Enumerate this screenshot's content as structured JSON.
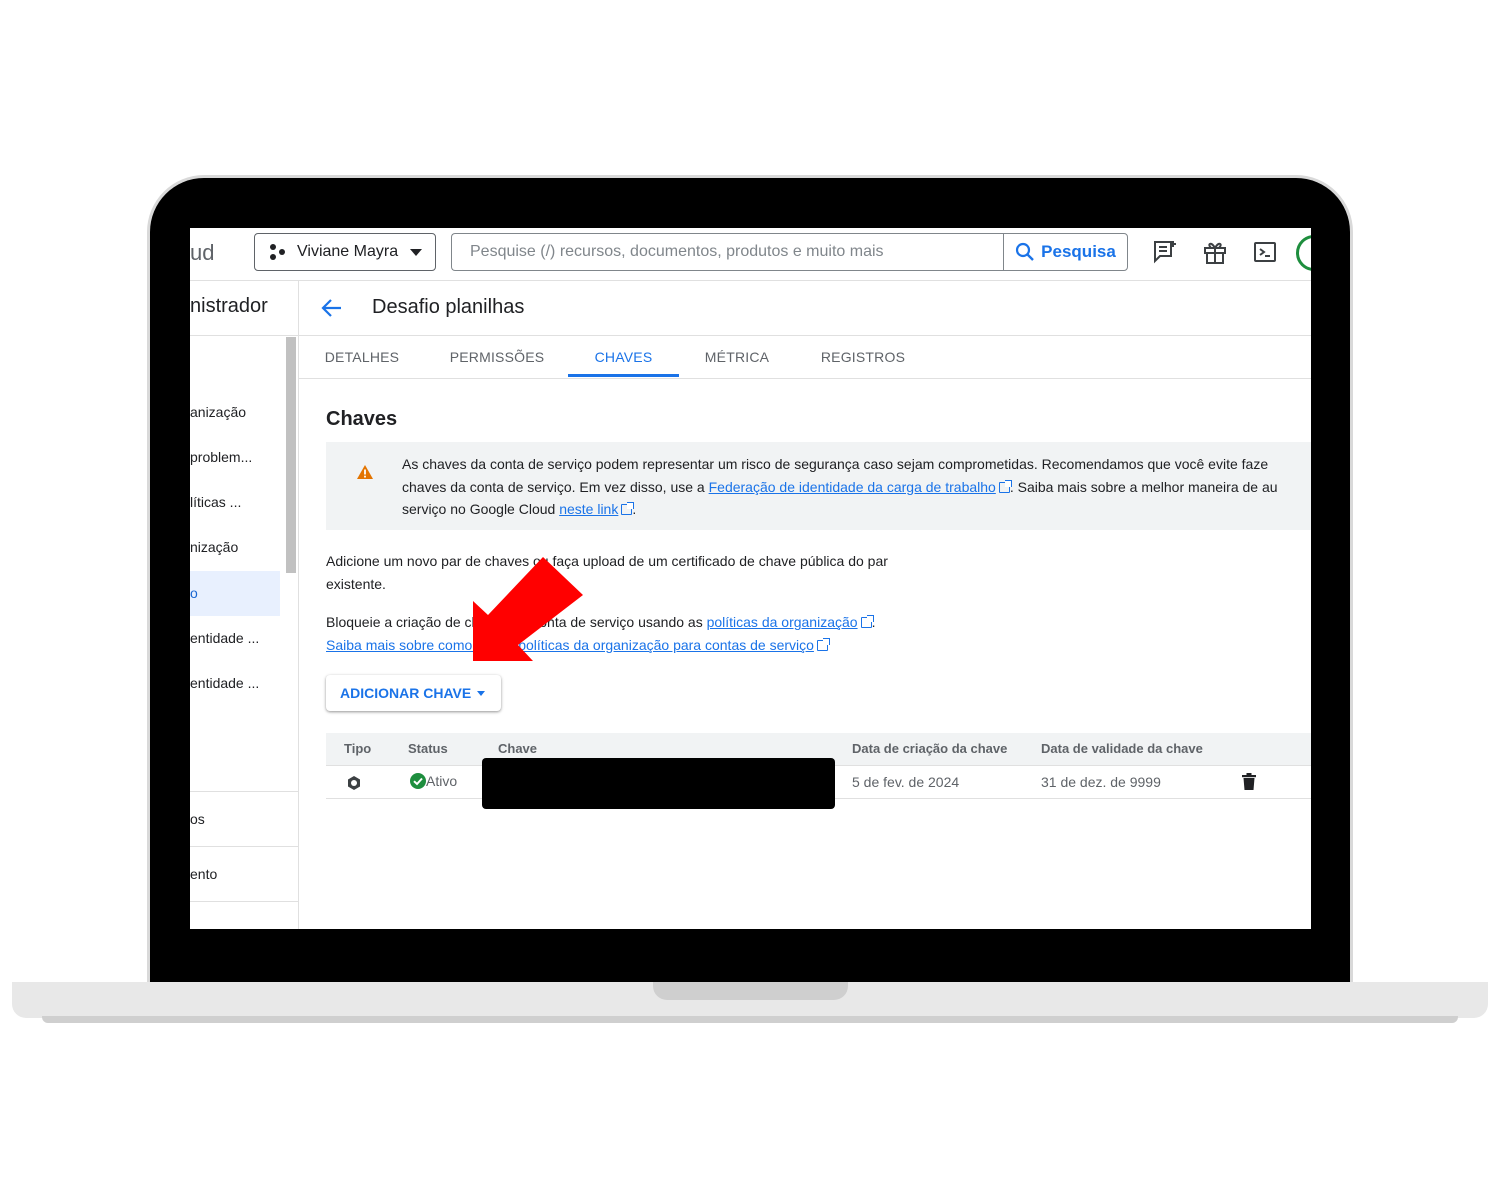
{
  "topbar": {
    "brand_fragment": "ud",
    "project_name": "Viviane Mayra",
    "search_placeholder": "Pesquise (/) recursos, documentos, produtos e muito mais",
    "search_button": "Pesquisa"
  },
  "sidenav": {
    "title_fragment": "nistrador",
    "items": [
      "anização",
      "problem...",
      "líticas ...",
      "nização",
      "o",
      "entidade ...",
      "entidade ..."
    ],
    "bottom_items": [
      "os",
      "ento"
    ]
  },
  "page": {
    "title": "Desafio planilhas",
    "tabs": [
      "DETALHES",
      "PERMISSÕES",
      "CHAVES",
      "MÉTRICA",
      "REGISTROS"
    ],
    "active_tab": "CHAVES",
    "section_title": "Chaves"
  },
  "warning": {
    "line1": "As chaves da conta de serviço podem representar um risco de segurança caso sejam comprometidas. Recomendamos que você evite faze",
    "line2_before": "chaves da conta de serviço. Em vez disso, use a ",
    "line2_link": "Federação de identidade da carga de trabalho",
    "line2_after": ". Saiba mais sobre a melhor maneira de au",
    "line3_before": "serviço no Google Cloud ",
    "line3_link": "neste link",
    "line3_after": "."
  },
  "body": {
    "para1": "Adicione um novo par de chaves ou faça upload de um certificado de chave pública do par existente.",
    "para2_before": "Bloqueie a criação de chaves da conta de serviço usando as ",
    "para2_link": "políticas da organização",
    "para2_after": ".",
    "para3_link": "Saiba mais sobre como definir políticas da organização para contas de serviço"
  },
  "add_key_button": "ADICIONAR CHAVE",
  "table": {
    "headers": [
      "Tipo",
      "Status",
      "Chave",
      "Data de criação da chave",
      "Data de validade da chave"
    ],
    "rows": [
      {
        "status": "Ativo",
        "key": "",
        "created": "5 de fev. de 2024",
        "expires": "31 de dez. de 9999"
      }
    ]
  },
  "colors": {
    "accent": "#1a73e8",
    "warning": "#e37400",
    "success": "#1e8e3e",
    "annotation_arrow": "#ff0000"
  }
}
